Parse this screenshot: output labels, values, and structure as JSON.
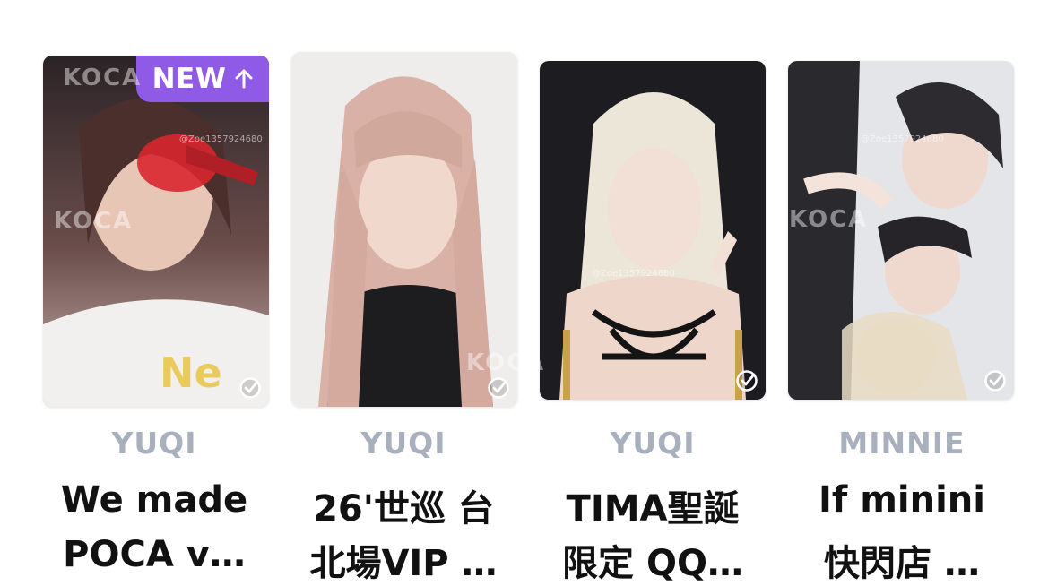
{
  "cards": [
    {
      "member": "YUQI",
      "title_lines": [
        "We made",
        "POCA v…"
      ],
      "badge": "NEW",
      "colors": {
        "bg1": "#3a2a2e",
        "bg2": "#c9a6a2",
        "accent": "#d8262f"
      }
    },
    {
      "member": "YUQI",
      "title_lines": [
        "26'世巡 台",
        "北場VIP …"
      ],
      "colors": {
        "bg1": "#f1efee",
        "bg2": "#d4b3aa",
        "accent": "#1b1b1b"
      }
    },
    {
      "member": "YUQI",
      "title_lines": [
        "TIMA聖誕",
        "限定 QQ…"
      ],
      "colors": {
        "bg1": "#1e1c22",
        "bg2": "#e9e2d6",
        "accent": "#c9a24b"
      }
    },
    {
      "member": "MINNIE",
      "title_lines": [
        "If minini",
        "快閃店 …"
      ],
      "colors": {
        "bg1": "#e6e7ea",
        "bg2": "#b9b6b8",
        "accent": "#2a2a2e"
      }
    }
  ],
  "watermark": {
    "logo": "KOCA",
    "handle": "@Zoe1357924680"
  },
  "colors": {
    "badge": "#8e5ae6",
    "member_label": "#a8b0bd",
    "title": "#111111"
  }
}
